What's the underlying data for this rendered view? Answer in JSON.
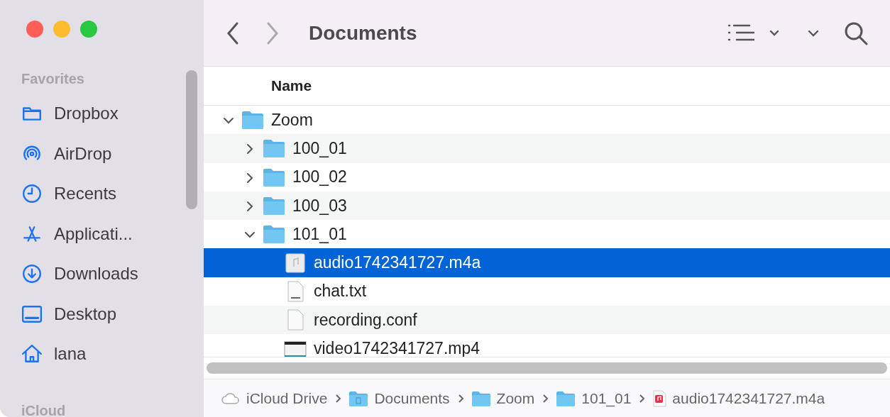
{
  "window": {
    "title": "Documents"
  },
  "sidebar": {
    "sections": [
      {
        "title": "Favorites",
        "items": [
          {
            "label": "Dropbox",
            "kind": "folder"
          },
          {
            "label": "AirDrop",
            "kind": "airdrop"
          },
          {
            "label": "Recents",
            "kind": "clock"
          },
          {
            "label": "Applicati...",
            "kind": "apps"
          },
          {
            "label": "Downloads",
            "kind": "download"
          },
          {
            "label": "Desktop",
            "kind": "desktop"
          },
          {
            "label": "lana",
            "kind": "home"
          }
        ]
      },
      {
        "title": "iCloud"
      }
    ]
  },
  "table": {
    "columns": [
      "Name"
    ],
    "rows": [
      {
        "name": "Zoom",
        "kind": "folder",
        "expanded": true,
        "selected": false,
        "children": [
          {
            "name": "100_01",
            "kind": "folder",
            "expanded": false,
            "selected": false
          },
          {
            "name": "100_02",
            "kind": "folder",
            "expanded": false,
            "selected": false
          },
          {
            "name": "100_03",
            "kind": "folder",
            "expanded": false,
            "selected": false
          },
          {
            "name": "101_01",
            "kind": "folder",
            "expanded": true,
            "selected": false,
            "children": [
              {
                "name": "audio1742341727.m4a",
                "kind": "audio",
                "selected": true
              },
              {
                "name": "chat.txt",
                "kind": "text",
                "selected": false
              },
              {
                "name": "recording.conf",
                "kind": "file",
                "selected": false
              },
              {
                "name": "video1742341727.mp4",
                "kind": "video",
                "selected": false
              }
            ]
          }
        ]
      }
    ]
  },
  "path_bar": [
    {
      "label": "iCloud Drive",
      "kind": "cloud"
    },
    {
      "label": "Documents",
      "kind": "docfolder"
    },
    {
      "label": "Zoom",
      "kind": "folder"
    },
    {
      "label": "101_01",
      "kind": "folder"
    },
    {
      "label": "audio1742341727.m4a",
      "kind": "audio"
    }
  ]
}
